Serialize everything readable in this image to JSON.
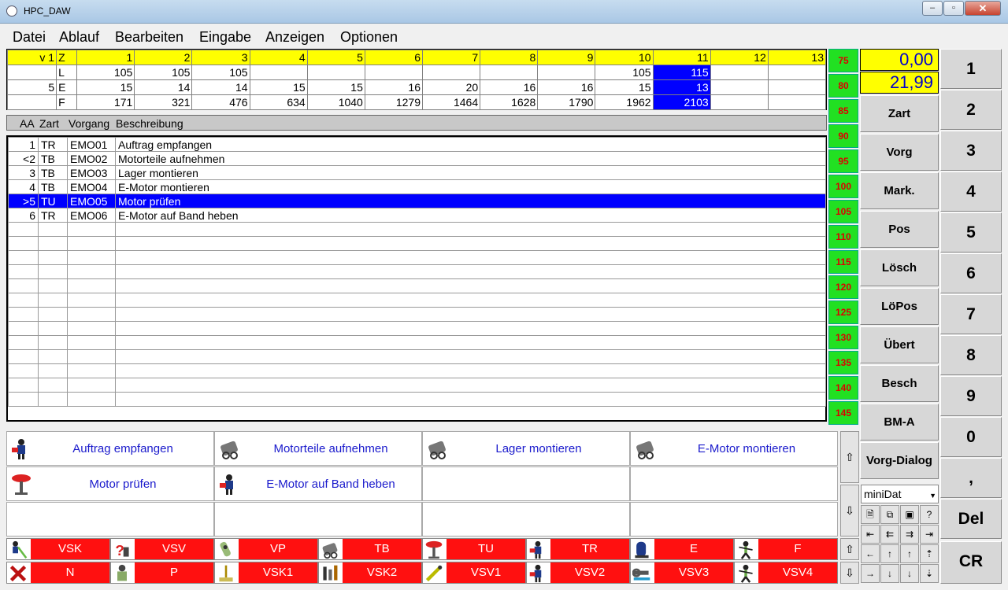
{
  "window": {
    "title": "HPC_DAW",
    "min": "–",
    "max": "▫",
    "close": "✕"
  },
  "menu": [
    "Datei",
    "Ablauf",
    "Bearbeiten",
    "Eingabe",
    "Anzeigen",
    "Optionen"
  ],
  "topgrid": {
    "header": [
      "v 1",
      "Z",
      "1",
      "2",
      "3",
      "4",
      "5",
      "6",
      "7",
      "8",
      "9",
      "10",
      "11",
      "12",
      "13"
    ],
    "rows": [
      [
        "",
        "L",
        "105",
        "105",
        "105",
        "",
        "",
        "",
        "",
        "",
        "",
        "105",
        "115",
        "",
        ""
      ],
      [
        "5",
        "E",
        "15",
        "14",
        "14",
        "15",
        "15",
        "16",
        "20",
        "16",
        "16",
        "15",
        "13",
        "",
        ""
      ],
      [
        "",
        "F",
        "171",
        "321",
        "476",
        "634",
        "1040",
        "1279",
        "1464",
        "1628",
        "1790",
        "1962",
        "2103",
        "",
        ""
      ]
    ],
    "selected_column": 12
  },
  "ruler": [
    "75",
    "80",
    "85",
    "90",
    "95",
    "100",
    "105",
    "110",
    "115",
    "120",
    "125",
    "130",
    "135",
    "140",
    "145"
  ],
  "values": {
    "top": "0,00",
    "bottom": "21,99"
  },
  "function_buttons": [
    "Zart",
    "Vorg",
    "Mark.",
    "Pos",
    "Lösch",
    "LöPos",
    "Übert",
    "Besch",
    "BM-A",
    "Vorg-Dialog"
  ],
  "keypad": [
    "1",
    "2",
    "3",
    "4",
    "5",
    "6",
    "7",
    "8",
    "9",
    "0",
    ",",
    "Del",
    "CR"
  ],
  "list": {
    "headers": [
      "AA",
      "Zart",
      "Vorgang",
      "Beschreibung"
    ],
    "rows": [
      [
        "1",
        "TR",
        "EMO01",
        "Auftrag empfangen"
      ],
      [
        "<2",
        "TB",
        "EMO02",
        "Motorteile aufnehmen"
      ],
      [
        "3",
        "TB",
        "EMO03",
        "Lager montieren"
      ],
      [
        "4",
        "TB",
        "EMO04",
        "E-Motor montieren"
      ],
      [
        ">5",
        "TU",
        "EMO05",
        "Motor prüfen"
      ],
      [
        "6",
        "TR",
        "EMO06",
        "E-Motor auf Band heben"
      ]
    ],
    "selected_row": 4,
    "empty_rows": 13
  },
  "process_buttons": [
    {
      "label": "Auftrag empfangen",
      "icon": "worker-icon"
    },
    {
      "label": "Motorteile aufnehmen",
      "icon": "motor-icon"
    },
    {
      "label": "Lager montieren",
      "icon": "motor-icon"
    },
    {
      "label": "E-Motor montieren",
      "icon": "motor-icon"
    },
    {
      "label": "Motor prüfen",
      "icon": "inspection-icon"
    },
    {
      "label": "E-Motor auf Band heben",
      "icon": "worker-icon"
    }
  ],
  "code_buttons": [
    {
      "label": "VSK",
      "icon": "pick-icon"
    },
    {
      "label": "VSV",
      "icon": "question-icon"
    },
    {
      "label": "VP",
      "icon": "tool-icon"
    },
    {
      "label": "TB",
      "icon": "motor-icon"
    },
    {
      "label": "TU",
      "icon": "inspection-icon"
    },
    {
      "label": "TR",
      "icon": "worker-icon"
    },
    {
      "label": "E",
      "icon": "chair-icon"
    },
    {
      "label": "F",
      "icon": "walker-icon"
    },
    {
      "label": "N",
      "icon": "cross-icon"
    },
    {
      "label": "P",
      "icon": "person-icon"
    },
    {
      "label": "VSK1",
      "icon": "broom-icon"
    },
    {
      "label": "VSK2",
      "icon": "tools-icon"
    },
    {
      "label": "VSV1",
      "icon": "pipette-icon"
    },
    {
      "label": "VSV2",
      "icon": "worker-icon"
    },
    {
      "label": "VSV3",
      "icon": "wrench-icon"
    },
    {
      "label": "VSV4",
      "icon": "walker-icon"
    }
  ],
  "minidat": {
    "selected": "miniDat"
  },
  "nav_arrows": {
    "up": "⇧",
    "down": "⇩"
  }
}
